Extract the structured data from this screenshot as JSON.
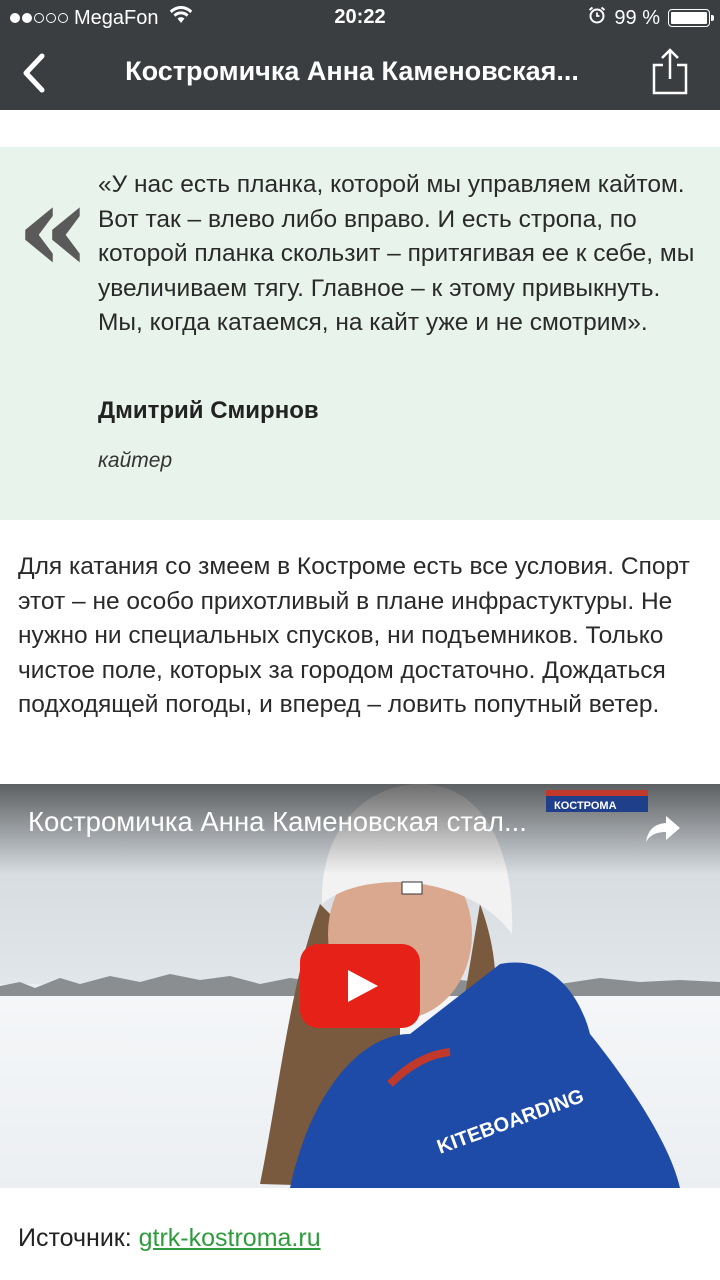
{
  "status_bar": {
    "carrier": "MegaFon",
    "time": "20:22",
    "battery_text": "99 %",
    "battery_level": 0.99,
    "signal_bars_full": 2,
    "signal_bars_total": 5
  },
  "nav": {
    "title": "Костромичка Анна Каменовская...",
    "back_icon": "chevron-left-icon",
    "share_icon": "share-icon"
  },
  "quote": {
    "mark": "«",
    "text": "«У нас есть планка, которой мы управляем кайтом. Вот так – влево либо вправо. И есть стропа, по которой планка скользит – притягивая ее к себе, мы увеличиваем тягу. Главное – к этому привыкнуть. Мы, когда катаемся, на кайт уже и не смотрим».",
    "author": "Дмитрий Смирнов",
    "role": "кайтер",
    "background": "#e8f3ec"
  },
  "article": {
    "paragraph": "Для катания со змеем в Костроме есть все условия. Спорт этот – не особо прихотливый в плане инфрастуктуры. Не нужно ни специальных спусков, ни подъемников. Только чистое поле, которых за городом достаточно. Дождаться подходящей погоды, и вперед – ловить попутный ветер."
  },
  "video": {
    "title": "Костромичка Анна Каменовская стал...",
    "channel_badge": "КОСТРОМА",
    "jacket_text": "KITEBOARDING",
    "play_color": "#e62117"
  },
  "source": {
    "label": "Источник: ",
    "link_text": "gtrk-kostroma.ru",
    "link_color": "#2e9c3c"
  }
}
